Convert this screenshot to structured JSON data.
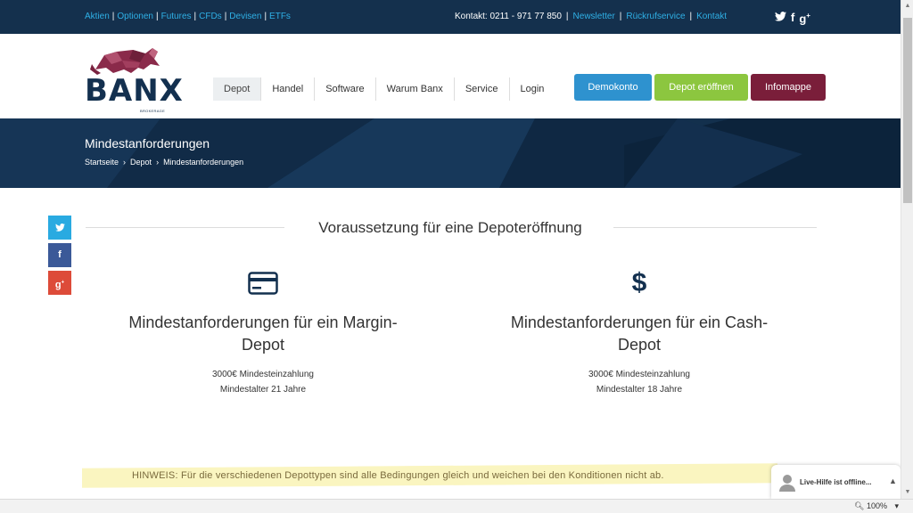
{
  "topbar": {
    "links": [
      "Aktien",
      "Optionen",
      "Futures",
      "CFDs",
      "Devisen",
      "ETFs"
    ],
    "contact": "Kontakt:  0211 - 971 77 850",
    "right_links": [
      "Newsletter",
      "Rückrufservice",
      "Kontakt"
    ],
    "social": [
      "twitter-icon",
      "facebook-icon",
      "google-plus-icon"
    ]
  },
  "logo": {
    "text": "BANX",
    "sub": "BROKERAGE"
  },
  "nav": {
    "items": [
      "Depot",
      "Handel",
      "Software",
      "Warum Banx",
      "Service",
      "Login"
    ],
    "active": "Depot"
  },
  "buttons": {
    "demo": "Demokonto",
    "open": "Depot eröffnen",
    "info": "Infomappe"
  },
  "hero": {
    "title": "Mindestanforderungen",
    "breadcrumb": [
      "Startseite",
      "Depot",
      "Mindestanforderungen"
    ]
  },
  "share": {
    "twitter": "twitter-icon",
    "facebook": "facebook-icon",
    "googleplus": "google-plus-icon"
  },
  "section": {
    "title": "Voraussetzung für eine Depoteröffnung",
    "columns": [
      {
        "icon": "credit-card-icon",
        "title": "Mindestanforderungen für ein Margin-Depot",
        "lines": [
          "3000€ Mindesteinzahlung",
          "Mindestalter 21 Jahre"
        ]
      },
      {
        "icon": "dollar-icon",
        "icon_text": "$",
        "title": "Mindestanforderungen für ein Cash-Depot",
        "lines": [
          "3000€ Mindesteinzahlung",
          "Mindestalter 18 Jahre"
        ]
      }
    ]
  },
  "notice": {
    "text": "HINWEIS: Für die verschiedenen Depottypen sind alle Bedingungen gleich und weichen bei den Konditionen nicht ab."
  },
  "livehelp": {
    "text": "Live-Hilfe ist offline..."
  },
  "statusbar": {
    "zoom": "100%"
  },
  "colors": {
    "navy": "#14304d",
    "link_blue": "#2fb0e6",
    "demo": "#2e92cf",
    "open": "#8cc63f",
    "info": "#7a1e3a"
  }
}
